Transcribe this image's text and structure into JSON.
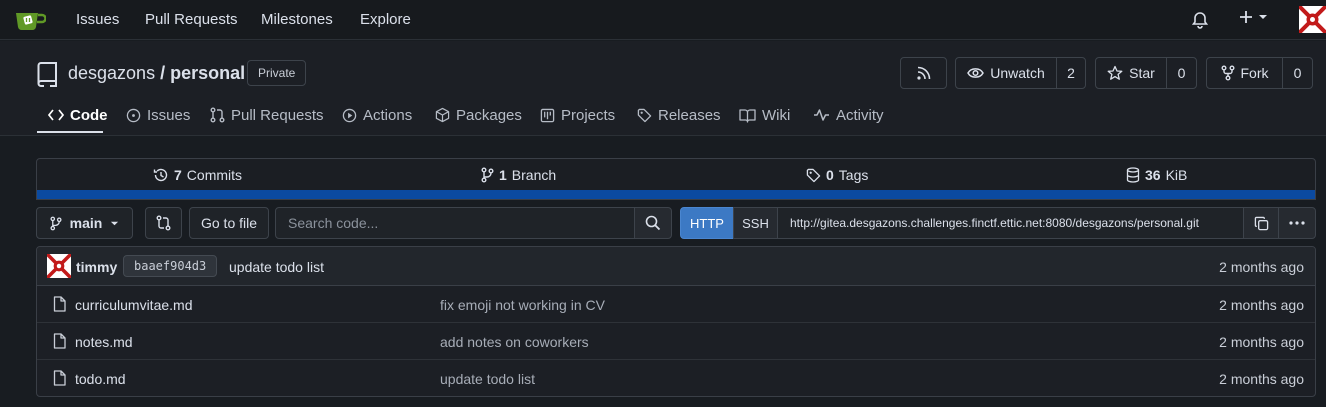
{
  "topnav": {
    "links": [
      "Issues",
      "Pull Requests",
      "Milestones",
      "Explore"
    ]
  },
  "repo": {
    "owner": "desgazons",
    "separator": " / ",
    "name": "personal",
    "visibility": "Private"
  },
  "actions": {
    "unwatch_label": "Unwatch",
    "watch_count": "2",
    "star_label": "Star",
    "star_count": "0",
    "fork_label": "Fork",
    "fork_count": "0"
  },
  "tabs": [
    {
      "label": "Code",
      "icon": "code-icon",
      "active": true
    },
    {
      "label": "Issues",
      "icon": "issue-icon"
    },
    {
      "label": "Pull Requests",
      "icon": "pull-request-icon"
    },
    {
      "label": "Actions",
      "icon": "play-icon"
    },
    {
      "label": "Packages",
      "icon": "package-icon"
    },
    {
      "label": "Projects",
      "icon": "project-icon"
    },
    {
      "label": "Releases",
      "icon": "tag-icon"
    },
    {
      "label": "Wiki",
      "icon": "book-icon"
    },
    {
      "label": "Activity",
      "icon": "pulse-icon"
    }
  ],
  "stats": {
    "commits_count": "7",
    "commits_label": "Commits",
    "branch_count": "1",
    "branch_label": "Branch",
    "tags_count": "0",
    "tags_label": "Tags",
    "size_value": "36",
    "size_unit": "KiB",
    "language_bar_color": "#0b4aa0"
  },
  "toolbar": {
    "branch": "main",
    "go_to_file": "Go to file",
    "search_placeholder": "Search code...",
    "http_label": "HTTP",
    "ssh_label": "SSH",
    "clone_url": "http://gitea.desgazons.challenges.finctf.ettic.net:8080/desgazons/personal.git"
  },
  "latest_commit": {
    "author": "timmy",
    "sha": "baaef904d3",
    "message": "update todo list",
    "time": "2 months ago"
  },
  "files": [
    {
      "name": "curriculumvitae.md",
      "message": "fix emoji not working in CV",
      "time": "2 months ago"
    },
    {
      "name": "notes.md",
      "message": "add notes on coworkers",
      "time": "2 months ago"
    },
    {
      "name": "todo.md",
      "message": "update todo list",
      "time": "2 months ago"
    }
  ],
  "colors": {
    "background": "#181c21",
    "accent": "#3c79c4",
    "logo_green": "#609926"
  }
}
